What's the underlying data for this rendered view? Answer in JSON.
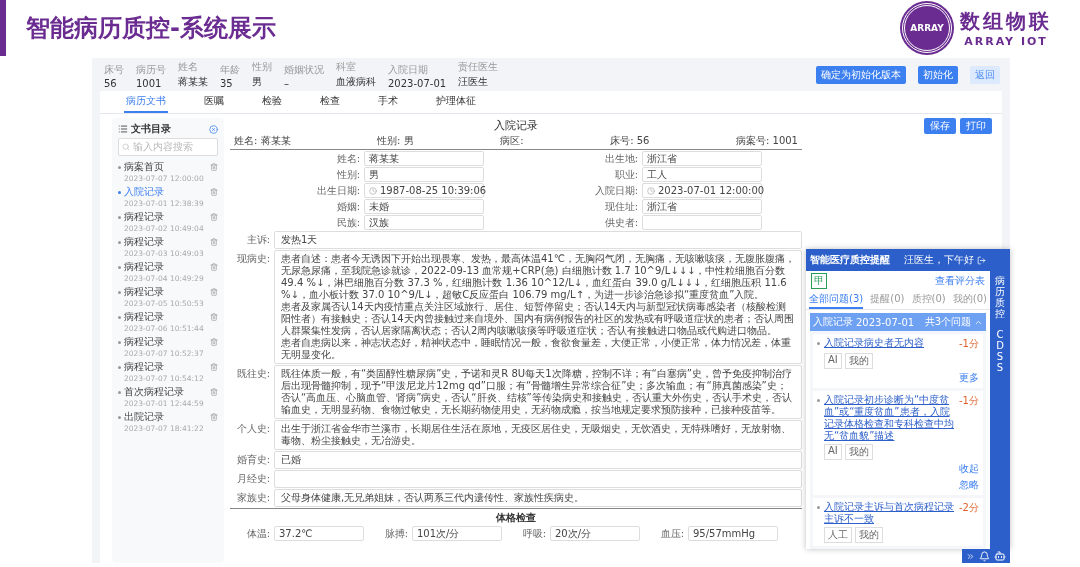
{
  "slide": {
    "title": "智能病历质控-系统展示",
    "logo": {
      "badge": "ARRAY",
      "name": "数组物联",
      "sub": "ARRAY IOT"
    }
  },
  "patient": {
    "fields": [
      {
        "label": "床号",
        "value": "56"
      },
      {
        "label": "病历号",
        "value": "1001"
      },
      {
        "label": "姓名",
        "value": "蒋某某"
      },
      {
        "label": "年龄",
        "value": "35"
      },
      {
        "label": "性别",
        "value": "男"
      },
      {
        "label": "婚姻状况",
        "value": "–"
      },
      {
        "label": "科室",
        "value": "血液病科"
      },
      {
        "label": "入院日期",
        "value": "2023-07-01"
      },
      {
        "label": "责任医生",
        "value": "汪医生"
      }
    ],
    "buttons": [
      {
        "label": "确定为初始化版本",
        "kind": "primary"
      },
      {
        "label": "初始化",
        "kind": "primary"
      },
      {
        "label": "返回",
        "kind": "light"
      }
    ]
  },
  "tabs": [
    {
      "label": "病历文书",
      "selected": true
    },
    {
      "label": "医嘱",
      "selected": false
    },
    {
      "label": "检验",
      "selected": false
    },
    {
      "label": "检查",
      "selected": false
    },
    {
      "label": "手术",
      "selected": false
    },
    {
      "label": "护理体征",
      "selected": false
    }
  ],
  "sidebar": {
    "title": "文书目录",
    "search_placeholder": "输入内容搜索",
    "items": [
      {
        "title": "病案首页",
        "time": "2023-07-07 12:00:00",
        "selected": false
      },
      {
        "title": "入院记录",
        "time": "2023-07-01 12:38:39",
        "selected": true
      },
      {
        "title": "病程记录",
        "time": "2023-07-02 10:49:04",
        "selected": false
      },
      {
        "title": "病程记录",
        "time": "2023-07-03 10:49:03",
        "selected": false
      },
      {
        "title": "病程记录",
        "time": "2023-07-04 10:49:29",
        "selected": false
      },
      {
        "title": "病程记录",
        "time": "2023-07-05 10:50:53",
        "selected": false
      },
      {
        "title": "病程记录",
        "time": "2023-07-06 10:51:44",
        "selected": false
      },
      {
        "title": "病程记录",
        "time": "2023-07-07 10:52:37",
        "selected": false
      },
      {
        "title": "病程记录",
        "time": "2023-07-07 10:54:12",
        "selected": false
      },
      {
        "title": "首次病程记录",
        "time": "2023-07-01 12:44:59",
        "selected": false
      },
      {
        "title": "出院记录",
        "time": "2023-07-07 18:41:22",
        "selected": false
      }
    ]
  },
  "record": {
    "title": "入院记录",
    "actions": [
      "保存",
      "打印"
    ],
    "summary": [
      {
        "label": "姓名:",
        "value": "蒋某某"
      },
      {
        "label": "性别:",
        "value": "男"
      },
      {
        "label": "病区:"
      },
      {
        "label": "床号:",
        "value": "56"
      },
      {
        "label": "病案号:",
        "value": "1001"
      }
    ],
    "fields": [
      {
        "label": "姓名:",
        "value": "蒋某某",
        "kind": "text"
      },
      {
        "label": "出生地:",
        "value": "浙江省",
        "kind": "text"
      },
      {
        "label": "性别:",
        "value": "男",
        "kind": "text"
      },
      {
        "label": "职业:",
        "value": "工人",
        "kind": "text"
      },
      {
        "label": "出生日期:",
        "value": "1987-08-25 10:39:06",
        "kind": "date"
      },
      {
        "label": "入院日期:",
        "value": "2023-07-01 12:00:00",
        "kind": "date"
      },
      {
        "label": "婚姻:",
        "value": "未婚",
        "kind": "text"
      },
      {
        "label": "现住址:",
        "value": "浙江省",
        "kind": "text"
      },
      {
        "label": "民族:",
        "value": "汉族",
        "kind": "text"
      },
      {
        "label": "供史者:",
        "kind": "text"
      }
    ],
    "sections": [
      {
        "label": "主诉:",
        "kind": "line",
        "paragraphs": [
          "发热1天"
        ]
      },
      {
        "label": "现病史:",
        "kind": "area",
        "paragraphs": [
          "患者自述：患者今无诱因下开始出现畏寒、发热，最高体温41℃，无胸闷气闭，无胸痛，无咳嗽咳痰，无腹胀腹痛，无尿急尿痛，至我院急诊就诊，2022-09-13 血常规+CRP(急) 白细胞计数 1.7 10^9/L↓↓↓，中性粒细胞百分数 49.4 %↓，淋巴细胞百分数 37.3 %，红细胞计数 1.36 10^12/L↓，血红蛋白 39.0 g/L↓↓↓，红细胞压积 11.6 %↓，血小板计数 37.0 10^9/L↓，超敏C反应蛋白 106.79 mg/L↑，为进一步诊治急诊拟“重度贫血”入院。",
          "患者及家属否认14天内疫情重点关注区域旅行、居住、短暂停留史；否认14天内与新型冠状病毒感染者（核酸检测阳性者）有接触史；否认14天内曾接触过来自境外、国内有病例报告的社区的发热或有呼吸道症状的患者；否认周围人群聚集性发病，否认居家隔离状态；否认2周内咳嗽咳痰等呼吸道症状；否认有接触进口物品或代购进口物品。",
          "患者自患病以来，神志状态好，精神状态中，睡眠情况一般，食欲食量差，大便正常，小便正常，体力情况差，体重无明显变化。"
        ]
      },
      {
        "label": "既往史:",
        "kind": "area",
        "paragraphs": [
          "既往体质一般，有“类固醇性糖尿病”史，予诺和灵R 8U每天1次降糖，控制不详；有“白塞病”史，曾予免疫抑制治疗后出现骨髓抑制，现予“甲泼尼龙片12mg qd”口服；有“骨髓增生异常综合征”史；多次输血；有“肺真菌感染”史；否认“高血压、心脑血管、肾病”病史，否认“肝炎、结核”等传染病史和接触史，否认重大外伤史，否认手术史，否认输血史，无明显药物、食物过敏史，无长期药物使用史，无药物成瘾，按当地规定要求预防接种，已接种疫苗等。"
        ]
      },
      {
        "label": "个人史:",
        "kind": "area",
        "paragraphs": [
          "出生于浙江省金华市兰溪市，长期居住生活在原地，无疫区居住史，无吸烟史，无饮酒史，无特殊嗜好，无放射物、毒物、粉尘接触史，无冶游史。"
        ]
      },
      {
        "label": "婚育史:",
        "kind": "area",
        "paragraphs": [
          "已婚"
        ]
      },
      {
        "label": "月经史:",
        "kind": "area"
      },
      {
        "label": "家族史:",
        "kind": "line",
        "paragraphs": [
          "父母身体健康,无兄弟姐妹，否认两系三代内遗传性、家族性疾病史。"
        ]
      }
    ],
    "exam": {
      "title": "体格检查",
      "fields": [
        {
          "label": "体温:",
          "value": "37.2℃"
        },
        {
          "label": "脉搏:",
          "value": "101次/分"
        },
        {
          "label": "呼吸:",
          "value": "20次/分"
        },
        {
          "label": "血压:",
          "value": "95/57mmHg"
        }
      ]
    }
  },
  "qc_panel": {
    "title": "智能医疗质控提醒",
    "greeting": "汪医生，下午好",
    "grade": "甲",
    "score_link": "查看评分表",
    "tabs": [
      {
        "label": "全部问题(3)",
        "selected": true
      },
      {
        "label": "提醒(0)",
        "selected": false
      },
      {
        "label": "质控(0)",
        "selected": false
      },
      {
        "label": "我的(0)",
        "selected": false
      }
    ],
    "side_tabs": [
      "病历质控",
      "CDSS"
    ],
    "group": {
      "title": "入院记录",
      "date": "2023-07-01",
      "count": "共3个问题"
    },
    "issues": [
      {
        "text": "入院记录病史者无内容",
        "score": "-1分",
        "tags": [
          "AI",
          "我的"
        ],
        "links": [
          "更多"
        ]
      },
      {
        "text": "入院记录初步诊断为“中度贫血”或“重度贫血”患者，入院记录体格检查和专科检查中均无“贫血貌”描述",
        "score": "-1分",
        "tags": [
          "AI",
          "我的"
        ],
        "links": [
          "收起",
          "忽略"
        ]
      },
      {
        "text": "入院记录主诉与首次病程记录主诉不一致",
        "score": "-2分",
        "tags": [
          "人工",
          "我的"
        ]
      }
    ]
  }
}
